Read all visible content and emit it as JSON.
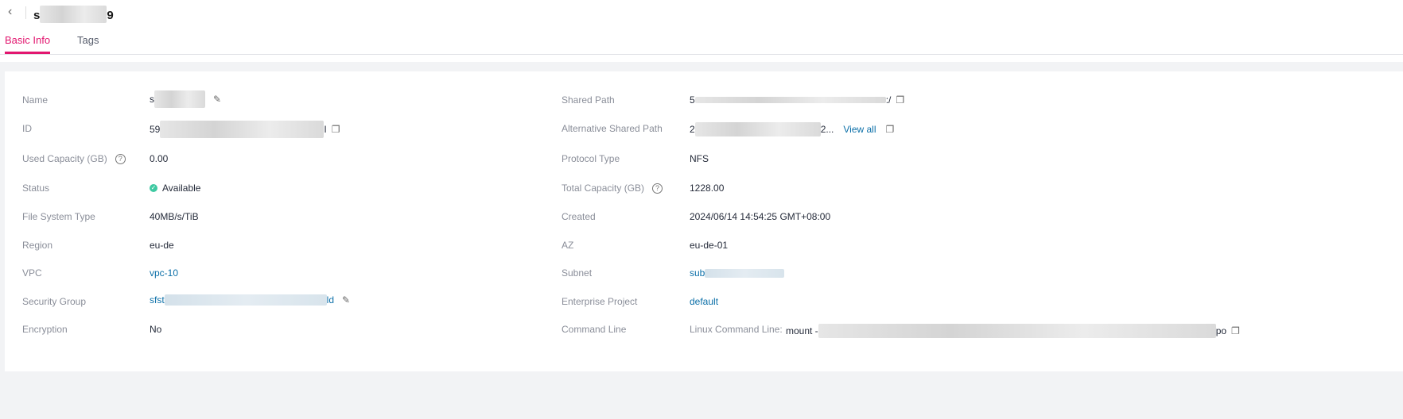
{
  "header": {
    "title_prefix": "s",
    "title_suffix": "9"
  },
  "tabs": [
    {
      "label": "Basic Info",
      "active": true
    },
    {
      "label": "Tags",
      "active": false
    }
  ],
  "left": [
    {
      "label": "Name",
      "value_prefix": "s"
    },
    {
      "label": "ID",
      "value_prefix": "59",
      "value_suffix": "I"
    },
    {
      "label": "Used Capacity (GB)",
      "value": "0.00"
    },
    {
      "label": "Status",
      "value": "Available"
    },
    {
      "label": "File System Type",
      "value": "40MB/s/TiB"
    },
    {
      "label": "Region",
      "value": "eu-de"
    },
    {
      "label": "VPC",
      "value": "vpc-10"
    },
    {
      "label": "Security Group",
      "value_prefix": "sfst",
      "value_suffix": "ld"
    },
    {
      "label": "Encryption",
      "value": "No"
    }
  ],
  "right": [
    {
      "label": "Shared Path",
      "value_prefix": "5",
      "value_suffix": ":/"
    },
    {
      "label": "Alternative Shared Path",
      "value_prefix": "2",
      "value_suffix": "2...",
      "link": "View all"
    },
    {
      "label": "Protocol Type",
      "value": "NFS"
    },
    {
      "label": "Total Capacity (GB)",
      "value": "1228.00"
    },
    {
      "label": "Created",
      "value": "2024/06/14 14:54:25 GMT+08:00"
    },
    {
      "label": "AZ",
      "value": "eu-de-01"
    },
    {
      "label": "Subnet",
      "value_prefix": "sub"
    },
    {
      "label": "Enterprise Project",
      "value": "default"
    },
    {
      "label": "Command Line",
      "sub_label": "Linux Command Line:",
      "value_prefix": "mount -",
      "value_suffix": "po"
    }
  ],
  "colors": {
    "accent": "#e2166f",
    "link": "#0b6fa8",
    "status_ok": "#3fc9a2"
  }
}
